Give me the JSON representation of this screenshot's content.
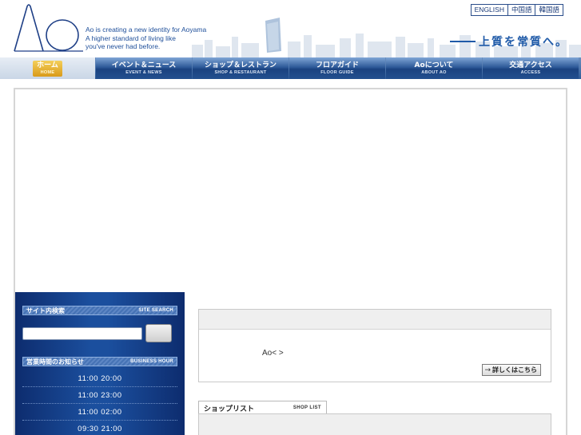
{
  "header": {
    "tagline": [
      "Ao is creating a new identity for Aoyama",
      "A higher standard of living like",
      "you've never had before."
    ],
    "languages": [
      "ENGLISH",
      "中国語",
      "韓国語"
    ],
    "slogan": "上質を常質へ。"
  },
  "nav": [
    {
      "jp": "ホーム",
      "en": "HOME",
      "active": true
    },
    {
      "jp": "イベント＆ニュース",
      "en": "EVENT & NEWS"
    },
    {
      "jp": "ショップ＆レストラン",
      "en": "SHOP & RESTAURANT"
    },
    {
      "jp": "フロアガイド",
      "en": "FLOOR GUIDE"
    },
    {
      "jp": "Aoについて",
      "en": "ABOUT AO"
    },
    {
      "jp": "交通アクセス",
      "en": "ACCESS"
    }
  ],
  "sidebar": {
    "search": {
      "jp": "サイト内検索",
      "en": "SITE SEARCH"
    },
    "hours": {
      "jp": "営業時間のお知らせ",
      "en": "BUSINESS HOUR",
      "rows": [
        "11:00 20:00",
        "11:00 23:00",
        "11:00 02:00",
        "09:30 21:00"
      ]
    }
  },
  "info": {
    "text": "Ao<  >",
    "more": "詳しくはこちら"
  },
  "shoplist": {
    "jp": "ショップリスト",
    "en": "SHOP LIST"
  },
  "colors": {
    "brand_blue": "#1f5aa8",
    "nav_dark": "#1a4280",
    "home_gold": "#d99a1a"
  }
}
